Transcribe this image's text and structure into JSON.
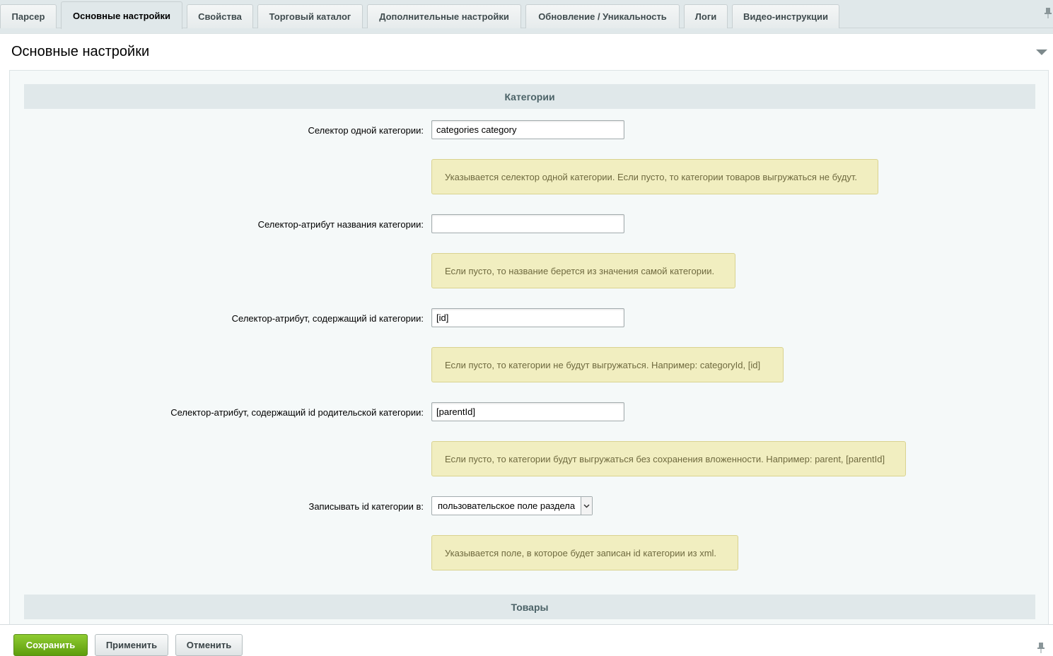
{
  "tabs": [
    {
      "label": "Парсер"
    },
    {
      "label": "Основные настройки"
    },
    {
      "label": "Свойства"
    },
    {
      "label": "Торговый каталог"
    },
    {
      "label": "Дополнительные настройки"
    },
    {
      "label": "Обновление / Уникальность"
    },
    {
      "label": "Логи"
    },
    {
      "label": "Видео-инструкции"
    }
  ],
  "panel": {
    "title": "Основные настройки"
  },
  "sections": {
    "categories": "Категории",
    "products": "Товары"
  },
  "fields": {
    "category_selector": {
      "label": "Селектор одной категории:",
      "value": "categories category",
      "hint": "Указывается селектор одной категории. Если пусто, то категории товаров выгружаться не будут."
    },
    "category_name_attr": {
      "label": "Селектор-атрибут названия категории:",
      "value": "",
      "hint": "Если пусто, то название берется из значения самой категории."
    },
    "category_id_attr": {
      "label": "Селектор-атрибут, содержащий id категории:",
      "value": "[id]",
      "hint": "Если пусто, то категории не будут выгружаться. Например: categoryId, [id]"
    },
    "parent_id_attr": {
      "label": "Селектор-атрибут, содержащий id родительской категории:",
      "value": "[parentId]",
      "hint": "Если пусто, то категории будут выгружаться без сохранения вложенности. Например: parent, [parentId]"
    },
    "write_id_to": {
      "label": "Записывать id категории в:",
      "value": "пользовательское поле раздела",
      "hint": "Указывается поле, в которое будет записан id категории из xml."
    }
  },
  "footer": {
    "save": "Сохранить",
    "apply": "Применить",
    "cancel": "Отменить"
  },
  "icons": {
    "pin": "pin-icon",
    "collapse": "collapse-arrow-icon",
    "select_arrow": "chevron-down-icon"
  }
}
